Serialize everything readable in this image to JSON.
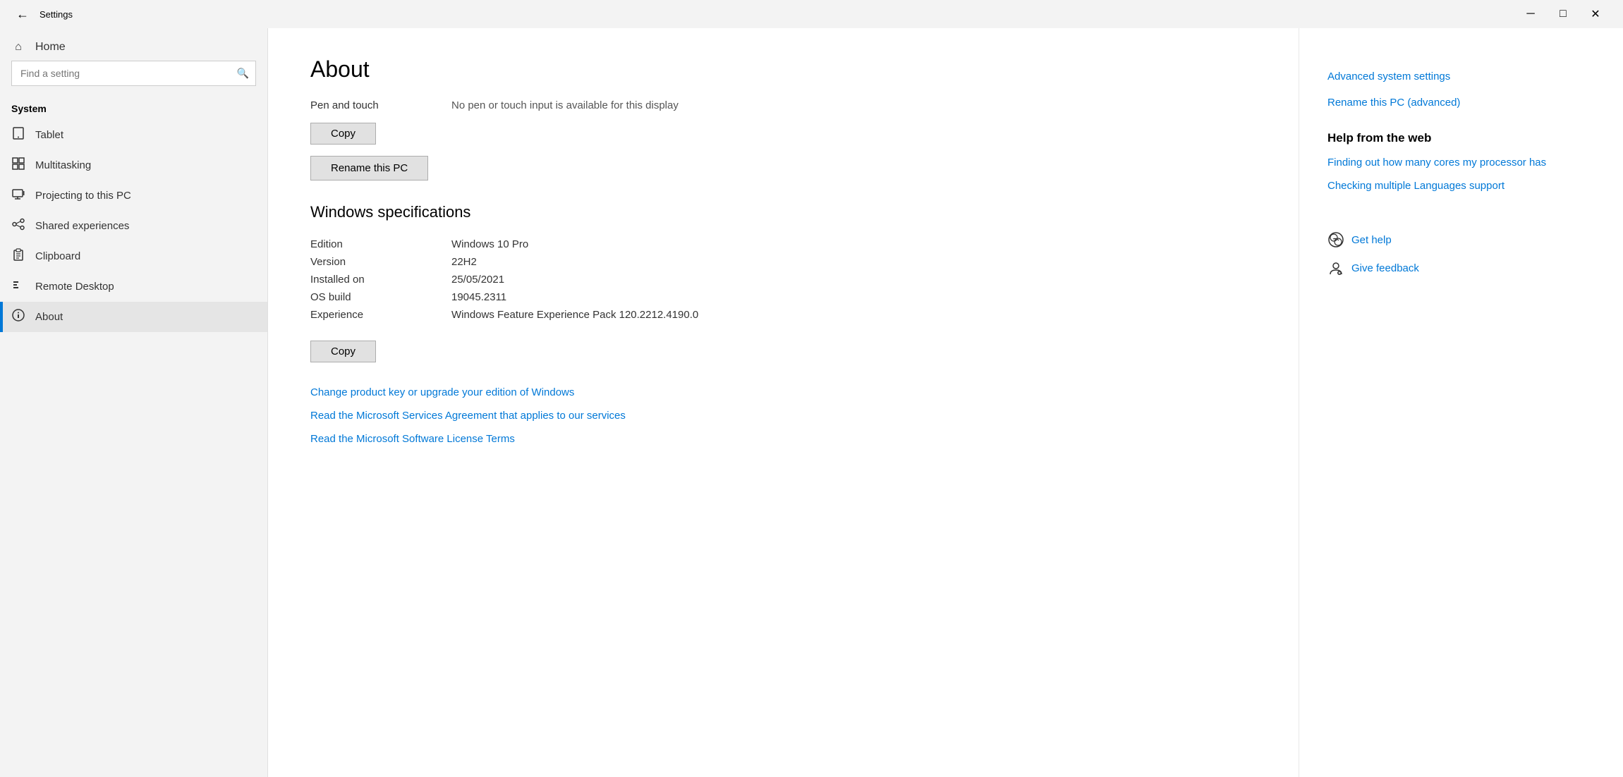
{
  "titleBar": {
    "title": "Settings",
    "minimizeLabel": "─",
    "restoreLabel": "□",
    "closeLabel": "✕"
  },
  "sidebar": {
    "searchPlaceholder": "Find a setting",
    "sectionLabel": "System",
    "homeLabel": "Home",
    "items": [
      {
        "id": "tablet",
        "label": "Tablet",
        "icon": "📱"
      },
      {
        "id": "multitasking",
        "label": "Multitasking",
        "icon": "⊞"
      },
      {
        "id": "projecting",
        "label": "Projecting to this PC",
        "icon": "🖥"
      },
      {
        "id": "shared",
        "label": "Shared experiences",
        "icon": "✕"
      },
      {
        "id": "clipboard",
        "label": "Clipboard",
        "icon": "📋"
      },
      {
        "id": "remote",
        "label": "Remote Desktop",
        "icon": "✕"
      },
      {
        "id": "about",
        "label": "About",
        "icon": "ℹ",
        "active": true
      }
    ]
  },
  "main": {
    "pageTitle": "About",
    "penTouchLabel": "Pen and touch",
    "penTouchValue": "No pen or touch input is available for this display",
    "copyButtonLabel": "Copy",
    "renameButtonLabel": "Rename this PC",
    "windowsSpecTitle": "Windows specifications",
    "specs": [
      {
        "label": "Edition",
        "value": "Windows 10 Pro"
      },
      {
        "label": "Version",
        "value": "22H2"
      },
      {
        "label": "Installed on",
        "value": "25/05/2021"
      },
      {
        "label": "OS build",
        "value": "19045.2311"
      },
      {
        "label": "Experience",
        "value": "Windows Feature Experience Pack 120.2212.4190.0"
      }
    ],
    "copySpecsButtonLabel": "Copy",
    "links": [
      "Change product key or upgrade your edition of Windows",
      "Read the Microsoft Services Agreement that applies to our services",
      "Read the Microsoft Software License Terms"
    ]
  },
  "rightPanel": {
    "advancedLink": "Advanced system settings",
    "renameAdvancedLink": "Rename this PC (advanced)",
    "helpFromWebTitle": "Help from the web",
    "webLinks": [
      "Finding out how many cores my processor has",
      "Checking multiple Languages support"
    ],
    "getHelpLabel": "Get help",
    "giveFeedbackLabel": "Give feedback"
  }
}
